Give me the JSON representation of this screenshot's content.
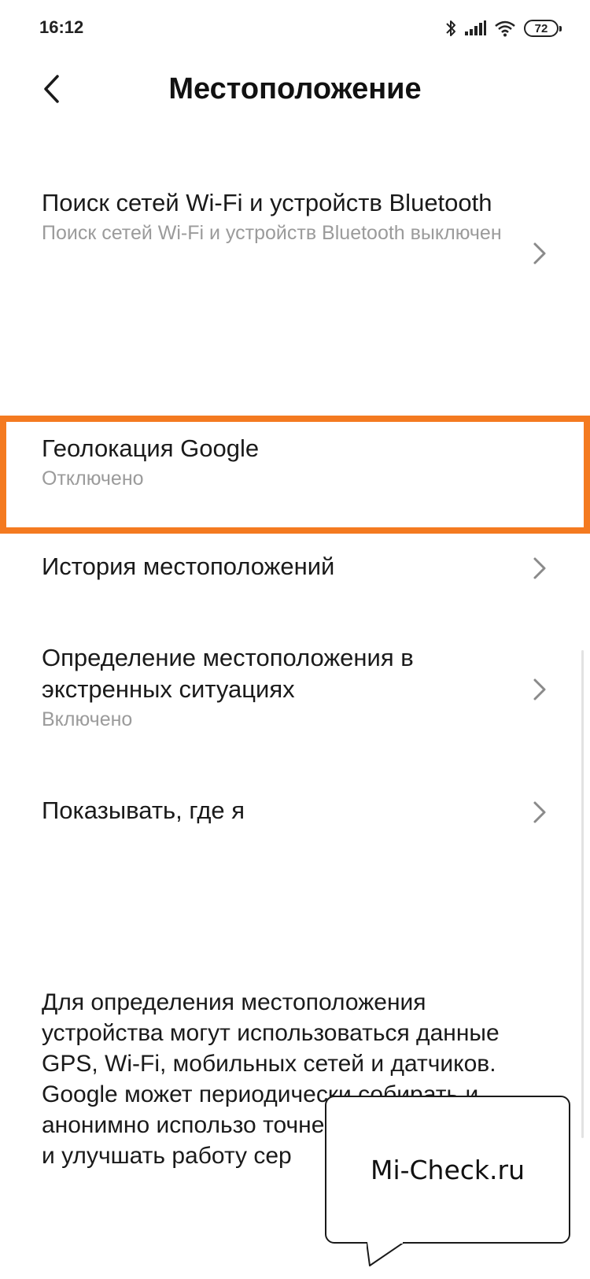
{
  "status_bar": {
    "time": "16:12",
    "battery": "72",
    "icons": [
      "bluetooth-icon",
      "signal-icon",
      "wifi-icon",
      "battery-icon"
    ]
  },
  "header": {
    "back_icon": "chevron-left-icon",
    "title": "Местоположение"
  },
  "items": [
    {
      "title": "Поиск сетей Wi-Fi и устройств Bluetooth",
      "subtitle": "Поиск сетей Wi-Fi и устройств Bluetooth выключен",
      "has_chevron": true
    },
    {
      "title": "Геолокация Google",
      "subtitle": "Отключено",
      "has_chevron": false,
      "highlighted": true
    },
    {
      "title": "История местоположений",
      "has_chevron": true
    },
    {
      "title": "Определение местоположения в экстренных ситуациях",
      "subtitle": "Включено",
      "has_chevron": true
    },
    {
      "title": "Показывать, где я",
      "has_chevron": true
    }
  ],
  "description": "Для определения местоположения устройства могут использоваться данные GPS, Wi-Fi, мобильных сетей и датчиков. Google может периодически собирать и анонимно использо точнее определять ме и улучшать работу сер",
  "watermark": {
    "text": "Mi-Check.ru"
  },
  "colors": {
    "highlight": "#f47a20",
    "subtitle": "#9b9b9b",
    "text": "#1a1a1a",
    "background": "#ffffff"
  }
}
